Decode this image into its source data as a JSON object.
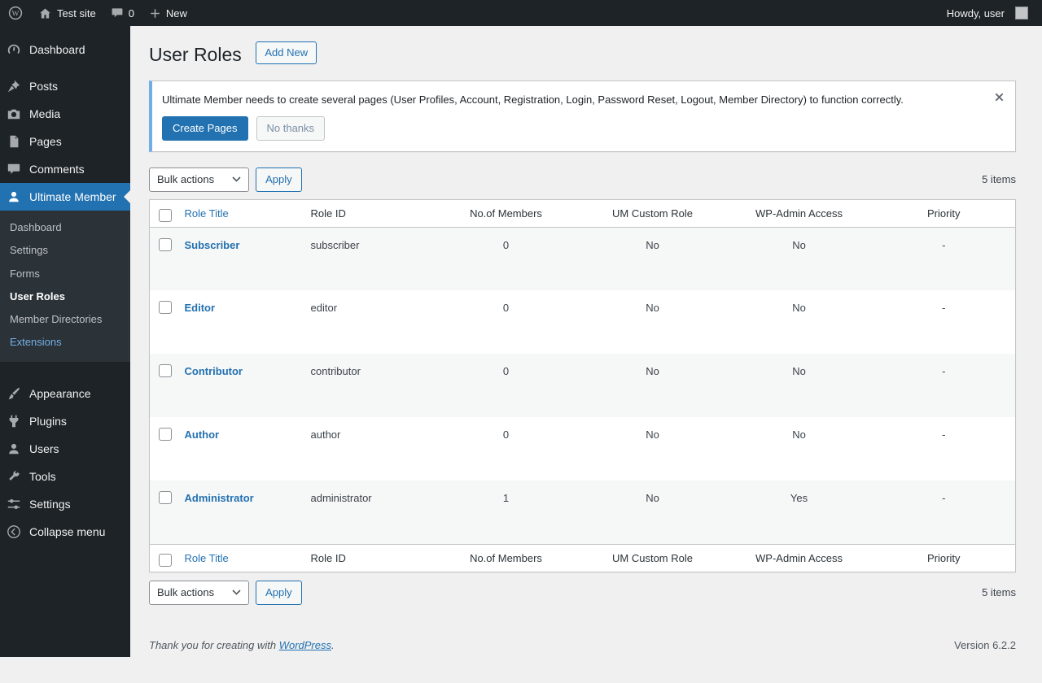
{
  "admin_bar": {
    "site_name": "Test site",
    "comments_count": "0",
    "new_label": "New",
    "howdy_text": "Howdy, user"
  },
  "sidebar": {
    "items": [
      {
        "label": "Dashboard"
      },
      {
        "label": "Posts"
      },
      {
        "label": "Media"
      },
      {
        "label": "Pages"
      },
      {
        "label": "Comments"
      },
      {
        "label": "Ultimate Member"
      },
      {
        "label": "Appearance"
      },
      {
        "label": "Plugins"
      },
      {
        "label": "Users"
      },
      {
        "label": "Tools"
      },
      {
        "label": "Settings"
      }
    ],
    "um_submenu": [
      {
        "label": "Dashboard"
      },
      {
        "label": "Settings"
      },
      {
        "label": "Forms"
      },
      {
        "label": "User Roles"
      },
      {
        "label": "Member Directories"
      },
      {
        "label": "Extensions"
      }
    ],
    "collapse_label": "Collapse menu"
  },
  "page": {
    "title": "User Roles",
    "add_new_label": "Add New"
  },
  "notice": {
    "message": "Ultimate Member needs to create several pages (User Profiles, Account, Registration, Login, Password Reset, Logout, Member Directory) to function correctly.",
    "create_pages_label": "Create Pages",
    "no_thanks_label": "No thanks"
  },
  "toolbar": {
    "bulk_actions_label": "Bulk actions",
    "apply_label": "Apply",
    "items_count": "5 items"
  },
  "table": {
    "headers": {
      "role_title": "Role Title",
      "role_id": "Role ID",
      "members": "No.of Members",
      "um_custom_role": "UM Custom Role",
      "wp_admin_access": "WP-Admin Access",
      "priority": "Priority"
    },
    "rows": [
      {
        "title": "Subscriber",
        "role_id": "subscriber",
        "members": "0",
        "um_custom_role": "No",
        "wp_admin_access": "No",
        "priority": "-"
      },
      {
        "title": "Editor",
        "role_id": "editor",
        "members": "0",
        "um_custom_role": "No",
        "wp_admin_access": "No",
        "priority": "-"
      },
      {
        "title": "Contributor",
        "role_id": "contributor",
        "members": "0",
        "um_custom_role": "No",
        "wp_admin_access": "No",
        "priority": "-"
      },
      {
        "title": "Author",
        "role_id": "author",
        "members": "0",
        "um_custom_role": "No",
        "wp_admin_access": "No",
        "priority": "-"
      },
      {
        "title": "Administrator",
        "role_id": "administrator",
        "members": "1",
        "um_custom_role": "No",
        "wp_admin_access": "Yes",
        "priority": "-"
      }
    ]
  },
  "footer": {
    "thanks_text": "Thank you for creating with",
    "wordpress_link": "WordPress",
    "period": ".",
    "version": "Version 6.2.2"
  },
  "colors": {
    "accent": "#2271b1",
    "notice_border": "#72aee6",
    "admin_bar_bg": "#1d2327"
  }
}
